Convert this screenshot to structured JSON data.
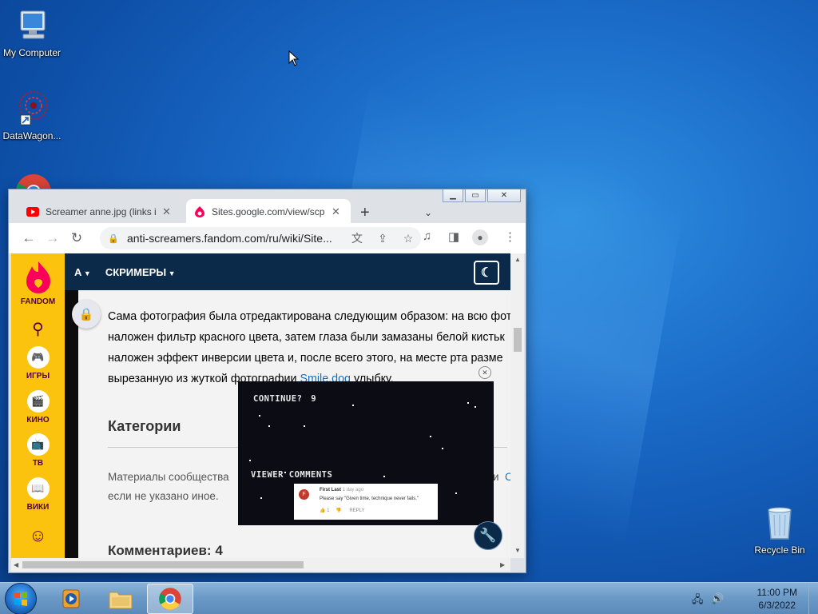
{
  "desktop": {
    "icons": [
      {
        "label": "My Computer"
      },
      {
        "label": "DataWagon..."
      },
      {
        "label": "Recycle Bin"
      }
    ]
  },
  "browser": {
    "tabs": [
      {
        "title": "Screamer anne.jpg (links in",
        "icon": "youtube-icon",
        "active": false
      },
      {
        "title": "Sites.google.com/view/scp",
        "icon": "fandom-icon",
        "active": true
      }
    ],
    "new_tab": "+",
    "tab_list": "⌄",
    "url": "anti-screamers.fandom.com/ru/wiki/Site..."
  },
  "page": {
    "sidebar": {
      "brand": "FANDOM",
      "items": [
        "ИГРЫ",
        "КИНО",
        "ТВ",
        "ВИКИ"
      ]
    },
    "nav": {
      "wiki_short": "A",
      "section": "СКРИМЕРЫ"
    },
    "article": {
      "lines": [
        "Сама фотография была отредактирована следующим образом: на всю фот",
        "наложен фильтр красного цвета, затем глаза были замазаны белой кистьк",
        "наложен эффект инверсии цвета и, после всего этого, на месте рта разме",
        "вырезанную из жуткой фотографии "
      ],
      "link_text": "Smile.dog",
      "line4_end": " улыбку.",
      "categories_heading": "Категории",
      "materials_line1": "Материалы сообщества",
      "materials_line1_end": "и",
      "materials_link": "С",
      "materials_line2": "если не указано иное.",
      "comments_heading": "Комментариев: 4"
    },
    "video_ad": {
      "continue_text": "CONTINUE?",
      "countdown": "9",
      "comments_label": "VIEWER COMMENTS",
      "comment": {
        "avatar_letter": "F",
        "author": "First Last",
        "time": "1 day ago",
        "text": "Please say \"Given time, technique never fails.\"",
        "likes": "1",
        "reply": "REPLY"
      }
    }
  },
  "taskbar": {
    "time": "11:00 PM",
    "date": "6/3/2022"
  },
  "colors": {
    "fandom_yellow": "#fbc30e",
    "fandom_navy": "#0b2a4a",
    "link": "#1a6fb8"
  }
}
